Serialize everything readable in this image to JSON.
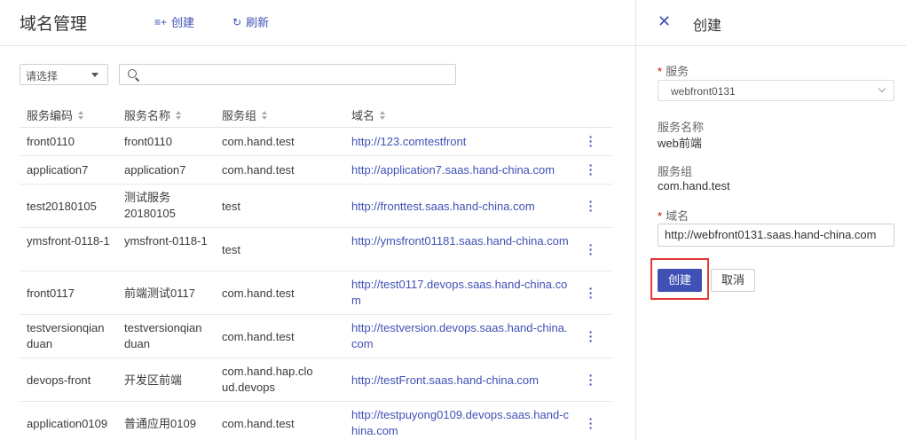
{
  "header": {
    "title": "域名管理",
    "create_label": "创建",
    "refresh_label": "刷新"
  },
  "filter": {
    "select_value": "请选择",
    "search_placeholder": ""
  },
  "table": {
    "columns": [
      "服务编码",
      "服务名称",
      "服务组",
      "域名"
    ],
    "rows": [
      {
        "code": "front0110",
        "name": "front0110",
        "group": "com.hand.test",
        "domain": "http://123.comtestfront"
      },
      {
        "code": "application7",
        "name": "application7",
        "group": "com.hand.test",
        "domain": "http://application7.saas.hand-china.com"
      },
      {
        "code": "test20180105",
        "name": "测试服务20180105",
        "group": "test",
        "domain": "http://fronttest.saas.hand-china.com"
      },
      {
        "code": "ymsfront-0118-1",
        "name": "ymsfront-0118-1",
        "group": "test",
        "domain": "http://ymsfront01181.saas.hand-china.com"
      },
      {
        "code": "front0117",
        "name": "前端测试0117",
        "group": "com.hand.test",
        "domain": "http://test0117.devops.saas.hand-china.com"
      },
      {
        "code": "testversionqianduan",
        "name": "testversionqianduan",
        "group": "com.hand.test",
        "domain": "http://testversion.devops.saas.hand-china.com"
      },
      {
        "code": "devops-front",
        "name": "开发区前端",
        "group": "com.hand.hap.cloud.devops",
        "domain": "http://testFront.saas.hand-china.com"
      },
      {
        "code": "application0109",
        "name": "普通应用0109",
        "group": "com.hand.test",
        "domain": "http://testpuyong0109.devops.saas.hand-china.com"
      }
    ]
  },
  "panel": {
    "title": "创建",
    "service_label": "服务",
    "service_value": "webfront0131",
    "service_name_label": "服务名称",
    "service_name_value": "web前端",
    "service_group_label": "服务组",
    "service_group_value": "com.hand.test",
    "domain_label": "域名",
    "domain_value": "http://webfront0131.saas.hand-china.com",
    "required_mark": "*",
    "create_button": "创建",
    "cancel_button": "取消"
  },
  "colors": {
    "accent": "#3f51b5",
    "highlight": "#e53935",
    "required": "#d50000"
  }
}
